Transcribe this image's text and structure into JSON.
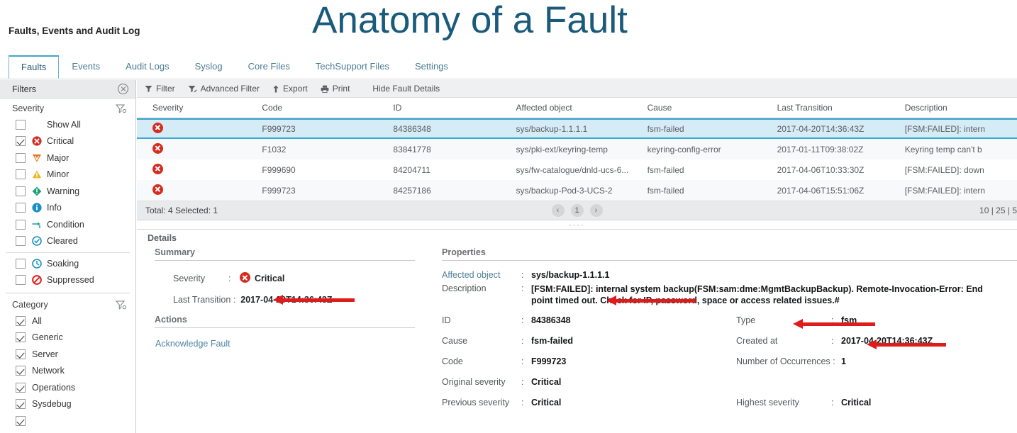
{
  "slide": {
    "title": "Anatomy of a Fault",
    "title_color": "#1a5a7a"
  },
  "app": {
    "heading": "Faults, Events and Audit Log",
    "tabs": [
      {
        "label": "Faults",
        "active": true
      },
      {
        "label": "Events",
        "active": false
      },
      {
        "label": "Audit Logs",
        "active": false
      },
      {
        "label": "Syslog",
        "active": false
      },
      {
        "label": "Core Files",
        "active": false
      },
      {
        "label": "TechSupport Files",
        "active": false
      },
      {
        "label": "Settings",
        "active": false
      }
    ]
  },
  "filters": {
    "panel_title": "Filters",
    "close_icon": "close-circle-icon",
    "severity": {
      "group_title": "Severity",
      "filter_icon": "funnel-icon",
      "items": [
        {
          "label": "Show All",
          "checked": false,
          "icon": "none"
        },
        {
          "label": "Critical",
          "checked": true,
          "icon": "critical-icon",
          "color": "#d62b1f"
        },
        {
          "label": "Major",
          "checked": false,
          "icon": "major-icon",
          "color": "#e8741c"
        },
        {
          "label": "Minor",
          "checked": false,
          "icon": "minor-icon",
          "color": "#f0b419"
        },
        {
          "label": "Warning",
          "checked": false,
          "icon": "warning-icon",
          "color": "#1a9e7e"
        },
        {
          "label": "Info",
          "checked": false,
          "icon": "info-icon",
          "color": "#1a8fc1"
        },
        {
          "label": "Condition",
          "checked": false,
          "icon": "condition-icon",
          "color": "#1a9e9e"
        },
        {
          "label": "Cleared",
          "checked": false,
          "icon": "cleared-icon",
          "color": "#1a8fc1"
        },
        {
          "label": "Soaking",
          "checked": false,
          "icon": "soaking-icon",
          "color": "#1a8fc1"
        },
        {
          "label": "Suppressed",
          "checked": false,
          "icon": "suppressed-icon",
          "color": "#e02020"
        }
      ]
    },
    "category": {
      "group_title": "Category",
      "filter_icon": "funnel-icon",
      "items": [
        {
          "label": "All",
          "checked": true
        },
        {
          "label": "Generic",
          "checked": true
        },
        {
          "label": "Server",
          "checked": true
        },
        {
          "label": "Network",
          "checked": true
        },
        {
          "label": "Operations",
          "checked": true
        },
        {
          "label": "Sysdebug",
          "checked": true
        }
      ]
    }
  },
  "toolbar": {
    "filter": "Filter",
    "advanced_filter": "Advanced Filter",
    "export": "Export",
    "print": "Print",
    "hide_details": "Hide Fault Details"
  },
  "table": {
    "columns": [
      "Severity",
      "Code",
      "ID",
      "Affected object",
      "Cause",
      "Last Transition",
      "Description"
    ],
    "rows": [
      {
        "severity_icon": "critical-icon",
        "code": "F999723",
        "id": "84386348",
        "object": "sys/backup-1.1.1.1",
        "cause": "fsm-failed",
        "last_transition": "2017-04-20T14:36:43Z",
        "description": "[FSM:FAILED]: intern",
        "selected": true
      },
      {
        "severity_icon": "critical-icon",
        "code": "F1032",
        "id": "83841778",
        "object": "sys/pki-ext/keyring-temp",
        "cause": "keyring-config-error",
        "last_transition": "2017-01-11T09:38:02Z",
        "description": "Keyring temp can't b",
        "selected": false
      },
      {
        "severity_icon": "critical-icon",
        "code": "F999690",
        "id": "84204711",
        "object": "sys/fw-catalogue/dnld-ucs-6...",
        "cause": "fsm-failed",
        "last_transition": "2017-04-06T10:33:30Z",
        "description": "[FSM:FAILED]: down",
        "selected": false
      },
      {
        "severity_icon": "critical-icon",
        "code": "F999723",
        "id": "84257186",
        "object": "sys/backup-Pod-3-UCS-2",
        "cause": "fsm-failed",
        "last_transition": "2017-04-06T15:51:06Z",
        "description": "[FSM:FAILED]: intern",
        "selected": false
      }
    ],
    "footer": {
      "total_text": "Total: 4 Selected: 1",
      "prev_icon": "chevron-left-icon",
      "current_page": "1",
      "next_icon": "chevron-right-icon",
      "page_sizes": "10 | 25 | 5"
    }
  },
  "details": {
    "title": "Details",
    "summary": {
      "section_title": "Summary",
      "severity_label": "Severity",
      "severity_value": "Critical",
      "severity_icon": "critical-icon",
      "last_transition_label": "Last Transition :",
      "last_transition_value": "2017-04-20T14:36:43Z"
    },
    "actions": {
      "section_title": "Actions",
      "acknowledge_link": "Acknowledge Fault"
    },
    "properties": {
      "section_title": "Properties",
      "affected_object_label": "Affected object",
      "affected_object_value": "sys/backup-1.1.1.1",
      "description_label": "Description",
      "description_value": "[FSM:FAILED]: internal system backup(FSM:sam:dme:MgmtBackupBackup). Remote-Invocation-Error: End point timed out. Check for IP, password, space or access related issues.#",
      "id_label": "ID",
      "id_value": "84386348",
      "type_label": "Type",
      "type_value": "fsm",
      "cause_label": "Cause",
      "cause_value": "fsm-failed",
      "created_at_label": "Created at",
      "created_at_value": "2017-04-20T14:36:43Z",
      "code_label": "Code",
      "code_value": "F999723",
      "occurrences_label": "Number of Occurrences :",
      "occurrences_value": "1",
      "original_severity_label": "Original severity",
      "original_severity_value": "Critical",
      "previous_severity_label": "Previous severity",
      "previous_severity_value": "Critical",
      "highest_severity_label": "Highest severity",
      "highest_severity_value": "Critical"
    }
  },
  "annotations": {
    "arrow_color": "#e01b1b",
    "count": 4
  }
}
